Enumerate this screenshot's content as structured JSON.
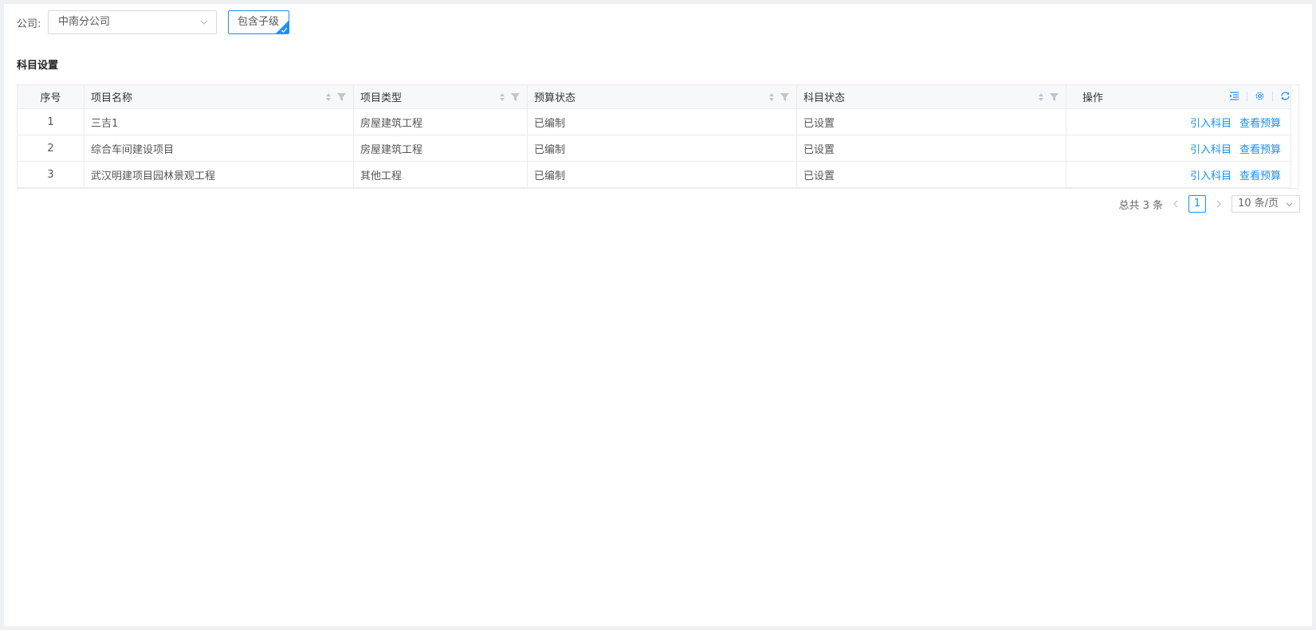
{
  "filters": {
    "company_label": "公司:",
    "company_value": "中南分公司",
    "include_children": "包含子级"
  },
  "section_title": "科目设置",
  "table": {
    "columns": [
      "序号",
      "项目名称",
      "项目类型",
      "预算状态",
      "科目状态",
      "操作"
    ],
    "rows": [
      {
        "index": "1",
        "name": "三吉1",
        "type": "房屋建筑工程",
        "budget": "已编制",
        "subject": "已设置"
      },
      {
        "index": "2",
        "name": "综合车间建设项目",
        "type": "房屋建筑工程",
        "budget": "已编制",
        "subject": "已设置"
      },
      {
        "index": "3",
        "name": "武汉明建项目园林景观工程",
        "type": "其他工程",
        "budget": "已编制",
        "subject": "已设置"
      }
    ],
    "actions": {
      "import": "引入科目",
      "view": "查看预算"
    }
  },
  "pagination": {
    "total": "总共 3 条",
    "current": "1",
    "page_size": "10 条/页"
  },
  "colors": {
    "accent": "#1890ff",
    "border": "#ebebeb",
    "header_bg": "#f7f8fa"
  }
}
